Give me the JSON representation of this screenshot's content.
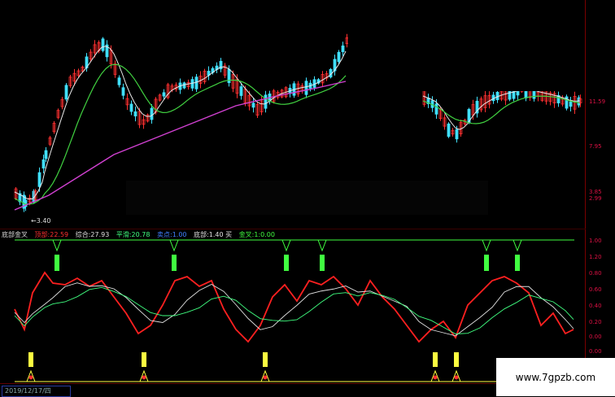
{
  "colors": {
    "background": "#000000",
    "candle_up": "#ff3030",
    "candle_down": "#40e0ff",
    "ma_white": "#e8e8e8",
    "ma_green": "#40d040",
    "ma_magenta": "#d040d0",
    "osc_red": "#ff2020",
    "osc_white": "#e0e0e0",
    "osc_green": "#40ff80",
    "signal_green": "#40ff40",
    "signal_yellow": "#ffff40",
    "axis_red": "#d01030"
  },
  "price_axis_labels": [
    "11.59",
    "7.95",
    "3.85",
    "2.99"
  ],
  "osc_axis_labels": [
    "1.00",
    "1.20",
    "0.80",
    "0.60",
    "0.40",
    "0.20",
    "0.00",
    "0.00"
  ],
  "low_note": "←3.40",
  "legend": {
    "name": "底部金叉",
    "items": [
      {
        "label": "顶部:22.59",
        "color": "#ff3030"
      },
      {
        "label": "综合:27.93",
        "color": "#e0e0e0"
      },
      {
        "label": "平滑:20.78",
        "color": "#40ff80"
      },
      {
        "label": "卖点:1.00",
        "color": "#4080ff"
      },
      {
        "label": "底部:1.40 买",
        "color": "#e0e0e0"
      },
      {
        "label": "金叉:1:0.00",
        "color": "#40ff40"
      }
    ]
  },
  "date_box": "2019/12/17/四",
  "watermark": "www.7gpzb.com"
}
